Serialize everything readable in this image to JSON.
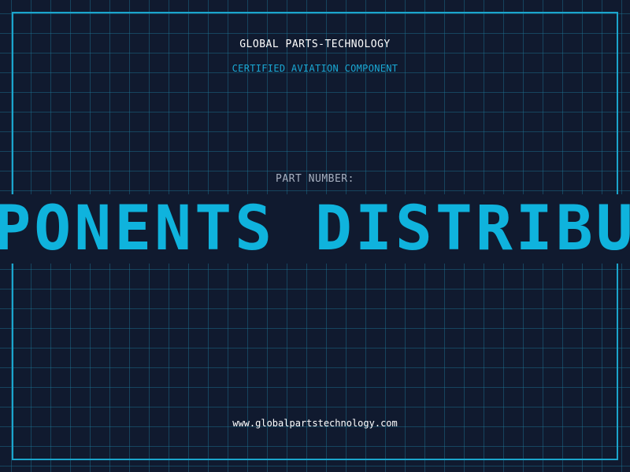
{
  "header": {
    "company": "GLOBAL PARTS-TECHNOLOGY",
    "subtitle": "CERTIFIED AVIATION COMPONENT"
  },
  "part": {
    "label": "PART NUMBER:",
    "value": "COMPONENTS DISTRIBUTOR"
  },
  "footer": {
    "url": "www.globalpartstechnology.com"
  },
  "colors": {
    "background": "#101a2f",
    "accent": "#1ba5cc",
    "part_number": "#0fb3dd"
  }
}
